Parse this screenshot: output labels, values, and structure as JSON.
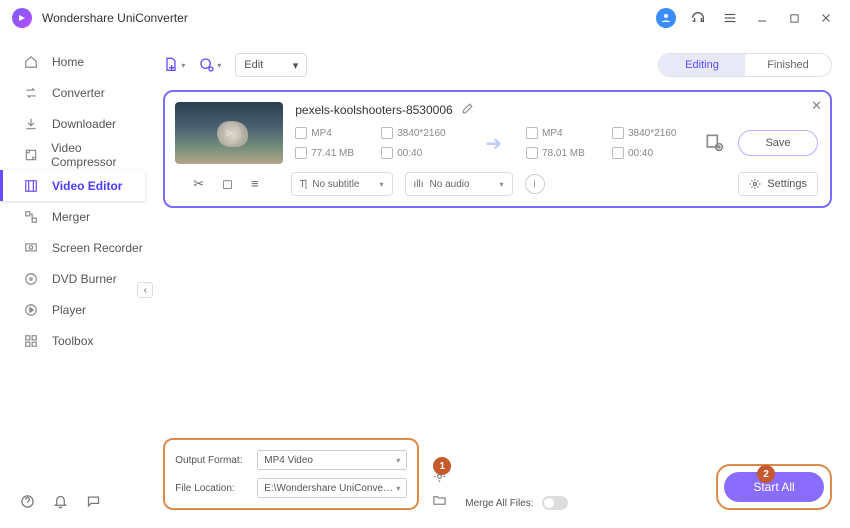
{
  "app": {
    "title": "Wondershare UniConverter"
  },
  "sidebar": {
    "items": [
      {
        "label": "Home"
      },
      {
        "label": "Converter"
      },
      {
        "label": "Downloader"
      },
      {
        "label": "Video Compressor"
      },
      {
        "label": "Video Editor"
      },
      {
        "label": "Merger"
      },
      {
        "label": "Screen Recorder"
      },
      {
        "label": "DVD Burner"
      },
      {
        "label": "Player"
      },
      {
        "label": "Toolbox"
      }
    ],
    "active_index": 4
  },
  "topbar": {
    "edit_label": "Edit",
    "tabs": [
      {
        "label": "Editing",
        "active": true
      },
      {
        "label": "Finished",
        "active": false
      }
    ]
  },
  "file": {
    "name": "pexels-koolshooters-8530006",
    "src": {
      "format": "MP4",
      "resolution": "3840*2160",
      "size": "77.41 MB",
      "duration": "00:40"
    },
    "dst": {
      "format": "MP4",
      "resolution": "3840*2160",
      "size": "78.01 MB",
      "duration": "00:40"
    },
    "save_label": "Save",
    "subtitle": "No subtitle",
    "audio": "No audio",
    "settings_label": "Settings"
  },
  "bottom": {
    "output_format_label": "Output Format:",
    "output_format_value": "MP4 Video",
    "file_location_label": "File Location:",
    "file_location_value": "E:\\Wondershare UniConverter",
    "merge_label": "Merge All Files:",
    "start_label": "Start All",
    "badges": {
      "one": "1",
      "two": "2"
    }
  }
}
